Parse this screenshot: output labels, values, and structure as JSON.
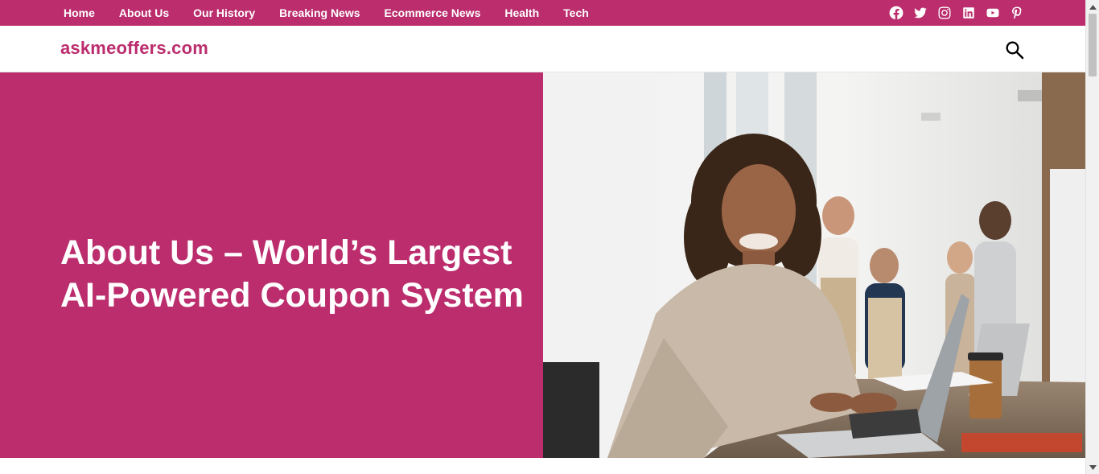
{
  "topnav": {
    "items": [
      {
        "label": "Home"
      },
      {
        "label": "About Us"
      },
      {
        "label": "Our History"
      },
      {
        "label": "Breaking News"
      },
      {
        "label": "Ecommerce News"
      },
      {
        "label": "Health"
      },
      {
        "label": "Tech"
      }
    ]
  },
  "social": {
    "icons": [
      "facebook-icon",
      "twitter-icon",
      "instagram-icon",
      "linkedin-icon",
      "youtube-icon",
      "pinterest-icon"
    ]
  },
  "header": {
    "site_title": "askmeoffers.com",
    "search_icon": "search-icon"
  },
  "hero": {
    "title_line1": "About Us – World’s Largest",
    "title_line2": "AI-Powered Coupon System"
  },
  "colors": {
    "brand": "#bb2d6d",
    "white": "#ffffff"
  }
}
